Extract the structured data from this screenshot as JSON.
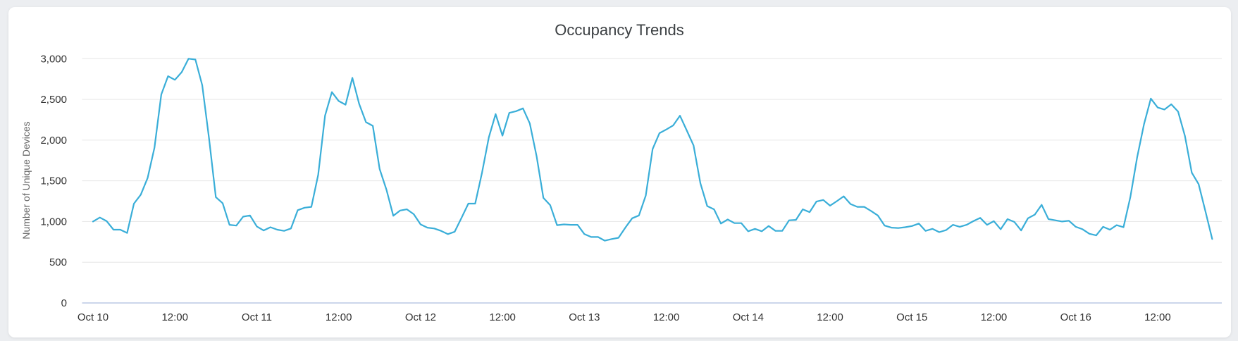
{
  "chart_data": {
    "type": "line",
    "title": "Occupancy Trends",
    "xlabel": "",
    "ylabel": "Number of Unique Devices",
    "x_unit": "hours since Oct 10 00:00",
    "x_start_hours": 0,
    "x_step_hours": 1,
    "xlim": [
      -1.6,
      165.4
    ],
    "ylim": [
      0,
      3000
    ],
    "y_ticks": [
      0,
      500,
      1000,
      1500,
      2000,
      2500,
      3000
    ],
    "y_tick_labels": [
      "0",
      "500",
      "1,000",
      "1,500",
      "2,000",
      "2,500",
      "3,000"
    ],
    "x_ticks": [
      {
        "hours": 0,
        "label": "Oct 10"
      },
      {
        "hours": 12,
        "label": "12:00"
      },
      {
        "hours": 24,
        "label": "Oct 11"
      },
      {
        "hours": 36,
        "label": "12:00"
      },
      {
        "hours": 48,
        "label": "Oct 12"
      },
      {
        "hours": 60,
        "label": "12:00"
      },
      {
        "hours": 72,
        "label": "Oct 13"
      },
      {
        "hours": 84,
        "label": "12:00"
      },
      {
        "hours": 96,
        "label": "Oct 14"
      },
      {
        "hours": 108,
        "label": "12:00"
      },
      {
        "hours": 120,
        "label": "Oct 15"
      },
      {
        "hours": 132,
        "label": "12:00"
      },
      {
        "hours": 144,
        "label": "Oct 16"
      },
      {
        "hours": 156,
        "label": "12:00"
      }
    ],
    "grid": true,
    "legend": "none",
    "series": [
      {
        "name": "Unique Devices",
        "color": "#3aaed8",
        "values": [
          1000,
          1050,
          1005,
          900,
          900,
          860,
          1220,
          1330,
          1535,
          1905,
          2560,
          2785,
          2740,
          2835,
          3000,
          2990,
          2675,
          2020,
          1300,
          1225,
          960,
          950,
          1060,
          1075,
          940,
          890,
          930,
          900,
          885,
          915,
          1140,
          1170,
          1180,
          1575,
          2300,
          2590,
          2480,
          2435,
          2765,
          2445,
          2220,
          2175,
          1645,
          1390,
          1070,
          1135,
          1150,
          1090,
          965,
          925,
          915,
          885,
          845,
          875,
          1045,
          1220,
          1220,
          1600,
          2035,
          2320,
          2055,
          2335,
          2355,
          2390,
          2205,
          1800,
          1290,
          1200,
          955,
          965,
          960,
          960,
          845,
          810,
          810,
          765,
          785,
          800,
          925,
          1040,
          1075,
          1320,
          1890,
          2085,
          2130,
          2180,
          2300,
          2120,
          1935,
          1470,
          1190,
          1150,
          975,
          1025,
          980,
          980,
          880,
          910,
          880,
          945,
          885,
          885,
          1015,
          1020,
          1150,
          1115,
          1245,
          1265,
          1195,
          1250,
          1310,
          1215,
          1180,
          1180,
          1130,
          1075,
          950,
          925,
          920,
          930,
          945,
          975,
          885,
          910,
          870,
          895,
          960,
          935,
          960,
          1005,
          1045,
          960,
          1005,
          905,
          1030,
          995,
          890,
          1040,
          1085,
          1205,
          1030,
          1015,
          1000,
          1010,
          935,
          905,
          850,
          830,
          935,
          900,
          955,
          930,
          1300,
          1790,
          2195,
          2510,
          2400,
          2375,
          2440,
          2350,
          2050,
          1600,
          1460,
          1125,
          785
        ]
      }
    ]
  }
}
